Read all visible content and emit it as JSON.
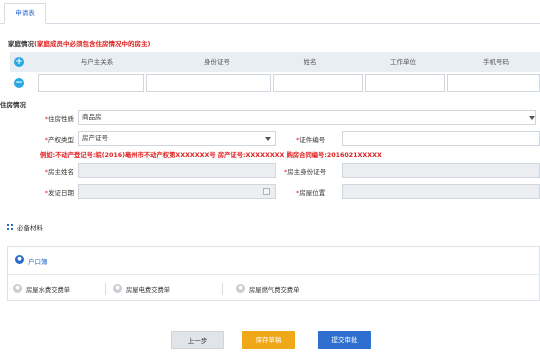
{
  "tab": {
    "label": "申请表"
  },
  "family": {
    "title": "家庭情况",
    "note": "(家庭成员中必须包含住房情况中的房主)",
    "columns": [
      "与户主关系",
      "身份证号",
      "姓名",
      "工作单位",
      "手机号码"
    ]
  },
  "housing": {
    "title": "住房情况",
    "nature_label": "住房性质",
    "nature_value": "商品房",
    "prop_type_label": "产权类型",
    "prop_type_value": "房产证号",
    "cert_no_label": "证件编号",
    "example": "例如:不动产登记号:皖(2016)亳州市不动产权第XXXXXXX号 房产证号:XXXXXXXX 购房合同编号:2016021XXXXX",
    "owner_name_label": "房主姓名",
    "owner_id_label": "房主身份证号",
    "issue_date_label": "发证日期",
    "location_label": "房屋位置",
    "star": "*"
  },
  "materials": {
    "title": "必备材料",
    "hukou": "户口簿",
    "bills": [
      "房屋水费交费单",
      "房屋电费交费单",
      "房屋燃气费交费单"
    ]
  },
  "buttons": {
    "prev": "上一步",
    "save": "保存草稿",
    "submit": "提交审批"
  },
  "colors": {
    "accent": "#2b6cc8",
    "required": "#e02020",
    "save": "#f0a818",
    "submit": "#2e6fd0"
  }
}
